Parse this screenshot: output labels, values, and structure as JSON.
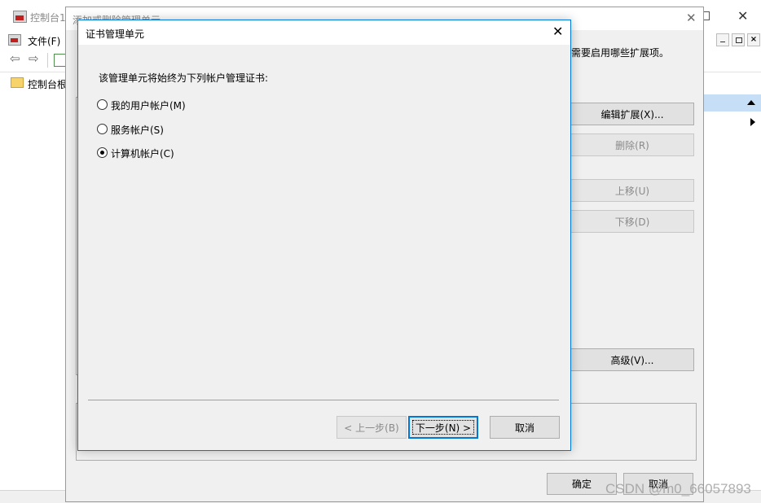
{
  "console": {
    "title": "控制台1",
    "menu_file": "文件(F)",
    "tree_root": "控制台根"
  },
  "addremove": {
    "title": "添加或删除管理单元",
    "instruction_tail": "需要启用哪些扩展项。",
    "buttons": {
      "edit_ext": "编辑扩展(X)...",
      "remove": "删除(R)",
      "move_up": "上移(U)",
      "move_down": "下移(D)",
      "advanced": "高级(V)...",
      "ok": "确定",
      "cancel": "取消"
    }
  },
  "dialog": {
    "title": "证书管理单元",
    "prompt": "该管理单元将始终为下列帐户管理证书:",
    "options": [
      {
        "label": "我的用户帐户(M)",
        "checked": false
      },
      {
        "label": "服务帐户(S)",
        "checked": false
      },
      {
        "label": "计算机帐户(C)",
        "checked": true
      }
    ],
    "back_label": "< 上一步(B)",
    "next_label": "下一步(N) >",
    "cancel_label": "取消"
  },
  "watermark": "CSDN @m0_66057893",
  "colors": {
    "accent": "#0078d7",
    "selected_bar": "#c7dff6",
    "disabled_text": "#8a8a8a"
  }
}
